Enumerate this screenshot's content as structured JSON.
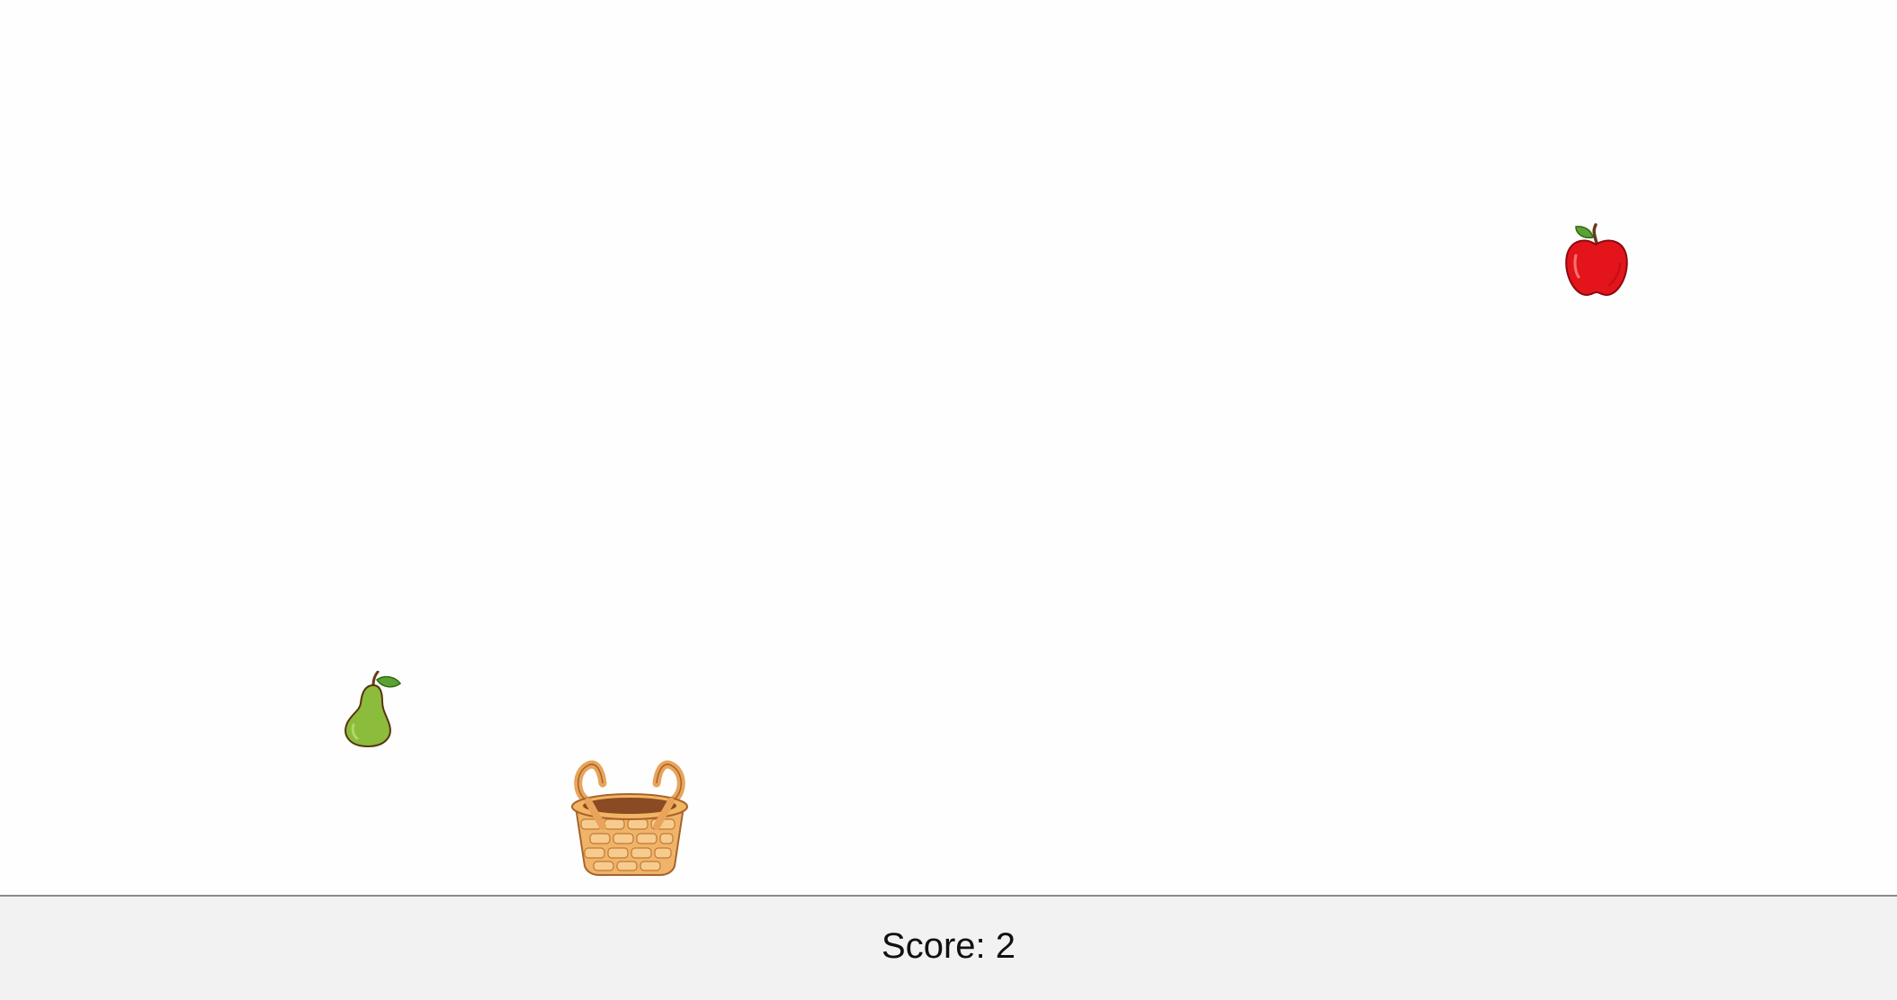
{
  "game": {
    "objects": [
      {
        "kind": "apple",
        "icon": "apple-icon"
      },
      {
        "kind": "pear",
        "icon": "pear-icon"
      },
      {
        "kind": "basket",
        "icon": "basket-icon"
      }
    ]
  },
  "score": {
    "label": "Score: 2",
    "value": 2
  },
  "colors": {
    "background": "#fefefe",
    "score_bar": "#f2f2f2",
    "apple": "#e4141b",
    "pear": "#8cbc3c",
    "basket": "#e8a45a"
  }
}
